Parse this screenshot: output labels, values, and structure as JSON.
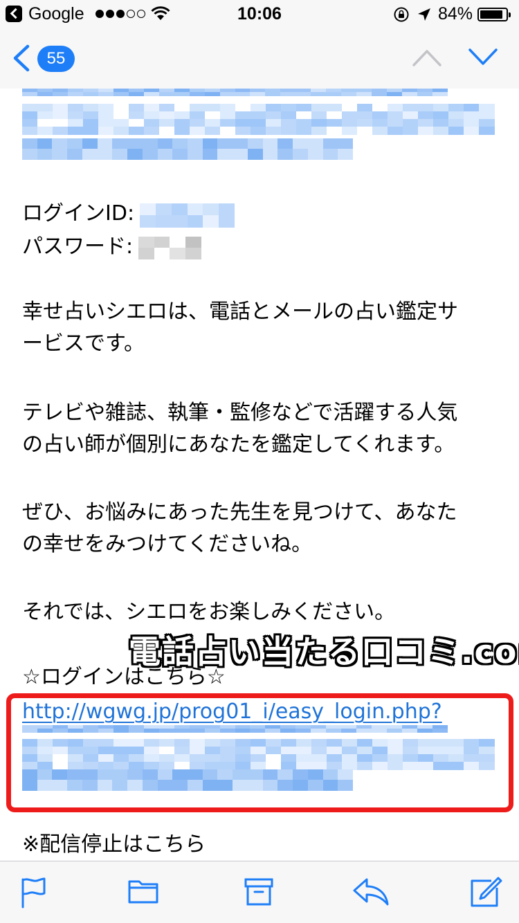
{
  "status_bar": {
    "carrier": "Google",
    "time": "10:06",
    "battery": "84%",
    "signal_bars_filled": 3,
    "signal_bars_total": 5
  },
  "nav": {
    "unread_count": "55"
  },
  "email": {
    "login_id_label": "ログインID:",
    "password_label": "パスワード:",
    "paragraph1_line1": "幸せ占いシエロは、電話とメールの占い鑑定サ",
    "paragraph1_line2": "ービスです。",
    "paragraph2_line1": "テレビや雑誌、執筆・監修などで活躍する人気",
    "paragraph2_line2": "の占い師が個別にあなたを鑑定してくれます。",
    "paragraph3_line1": "ぜひ、お悩みにあった先生を見つけて、あなた",
    "paragraph3_line2": "の幸せをみつけてくださいね。",
    "closing": "それでは、シエロをお楽しみください。",
    "login_heading": "☆ログインはこちら☆",
    "login_url": "http://wgwg.jp/prog01_i/easy_login.php?",
    "unsubscribe": "※配信停止はこちら"
  },
  "watermark": "電話占い当たる口コミ.com",
  "colors": {
    "link": "#1f73d8",
    "accent": "#1e7ef7",
    "highlight_box": "#ee1b1b",
    "bars": "#f7f7f8"
  },
  "toolbar": {
    "icons": [
      "flag-icon",
      "folder-icon",
      "archive-icon",
      "reply-icon",
      "compose-icon"
    ]
  }
}
